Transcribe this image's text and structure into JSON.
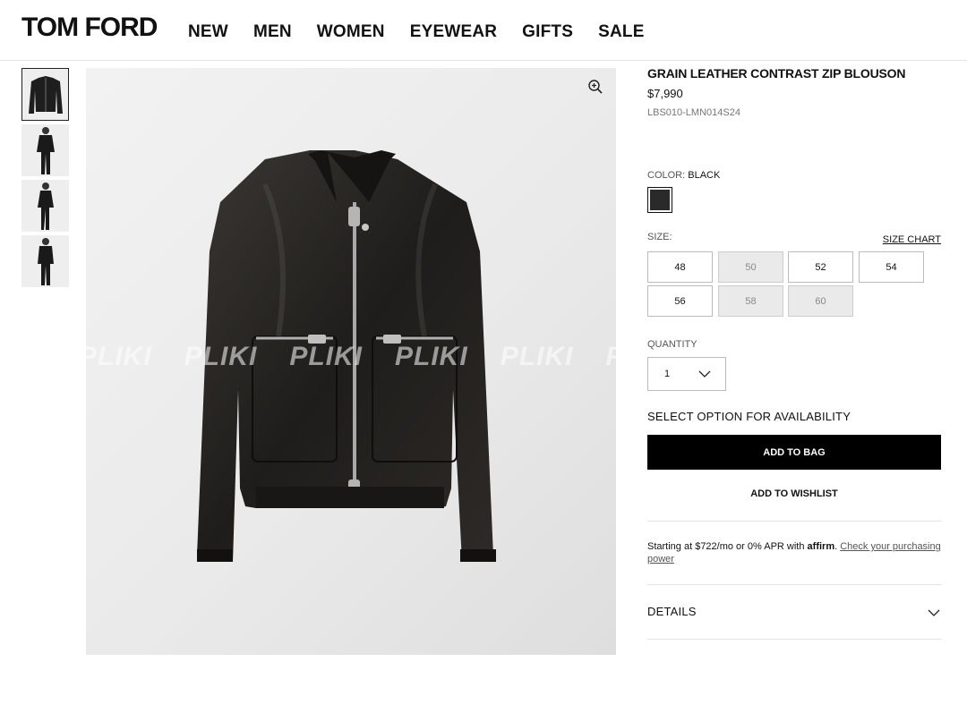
{
  "header": {
    "logo": "TOM FORD",
    "nav": [
      "NEW",
      "MEN",
      "WOMEN",
      "EYEWEAR",
      "GIFTS",
      "SALE"
    ]
  },
  "gallery": {
    "thumbnail_count": 4,
    "watermark": "PLIKI",
    "zoom_icon": "zoom-in-icon"
  },
  "product": {
    "title": "GRAIN LEATHER CONTRAST ZIP BLOUSON",
    "price": "$7,990",
    "sku": "LBS010-LMN014S24",
    "color_label": "COLOR:",
    "color_value": "BLACK",
    "swatch_color": "#2a2a2a",
    "size_label": "SIZE:",
    "size_chart": "SIZE CHART",
    "sizes": [
      {
        "label": "48",
        "available": true
      },
      {
        "label": "50",
        "available": false
      },
      {
        "label": "52",
        "available": true
      },
      {
        "label": "54",
        "available": true
      },
      {
        "label": "56",
        "available": true
      },
      {
        "label": "58",
        "available": false
      },
      {
        "label": "60",
        "available": false
      }
    ],
    "quantity_label": "QUANTITY",
    "quantity_value": "1",
    "availability": "SELECT OPTION FOR AVAILABILITY",
    "add_to_bag": "ADD TO BAG",
    "add_to_wishlist": "ADD TO WISHLIST",
    "affirm": {
      "text": "Starting at $722/mo or 0% APR with",
      "brand": "affirm",
      "link": "Check your purchasing power"
    },
    "details": "DETAILS"
  }
}
